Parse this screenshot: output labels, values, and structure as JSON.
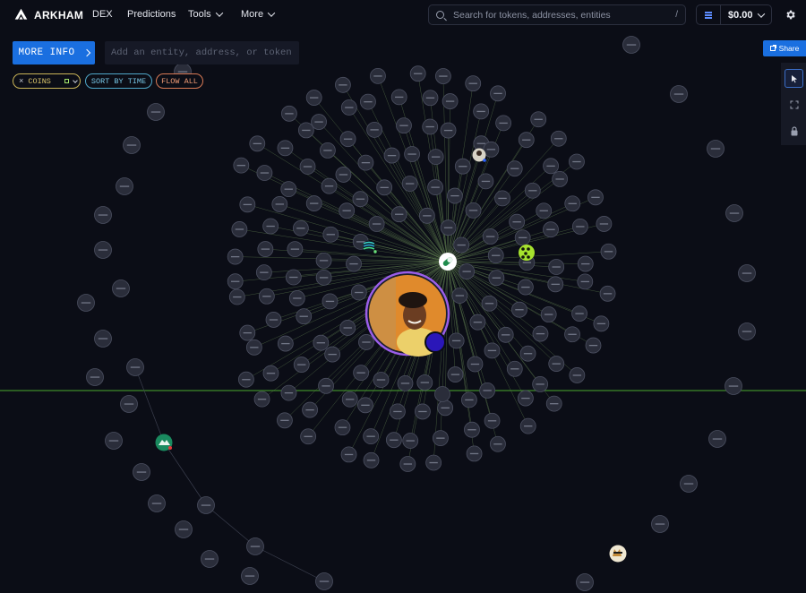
{
  "app": {
    "brand": "ARKHAM"
  },
  "nav": {
    "items": [
      {
        "label": "DEX",
        "has_menu": false
      },
      {
        "label": "Predictions",
        "has_menu": false
      },
      {
        "label": "Tools",
        "has_menu": true
      },
      {
        "label": "More",
        "has_menu": true
      }
    ]
  },
  "search": {
    "placeholder": "Search for tokens, addresses, entities",
    "shortcut": "/"
  },
  "wallet": {
    "balance": "$0.00"
  },
  "controls": {
    "more_info_label": "MORE INFO",
    "entity_input_placeholder": "Add an entity, address, or token",
    "filters": [
      {
        "label": "COINS"
      },
      {
        "label": "SORT BY TIME"
      },
      {
        "label": "FLOW ALL"
      }
    ],
    "share_label": "Share"
  },
  "tools": [
    {
      "icon": "cursor-icon",
      "active": true
    },
    {
      "icon": "expand-icon",
      "active": false
    },
    {
      "icon": "lock-icon",
      "active": false
    }
  ],
  "graph": {
    "central_entity": {
      "icon": "person-photo"
    },
    "hub_token": {
      "icon": "pill-token-icon"
    },
    "special_nodes": [
      "green-token-icon",
      "striped-token-icon",
      "avatar-node-icon",
      "cat-avatar-icon",
      "cloud-entity-icon",
      "purple-entity-icon"
    ],
    "colors": {
      "background": "#0b0d16",
      "edge": "#5c7a4e",
      "node_fill": "#2a2d3a",
      "node_stroke": "#4b4f60",
      "central_ring": "#9a5ee8",
      "horizon_line": "#3f8d2a"
    }
  }
}
